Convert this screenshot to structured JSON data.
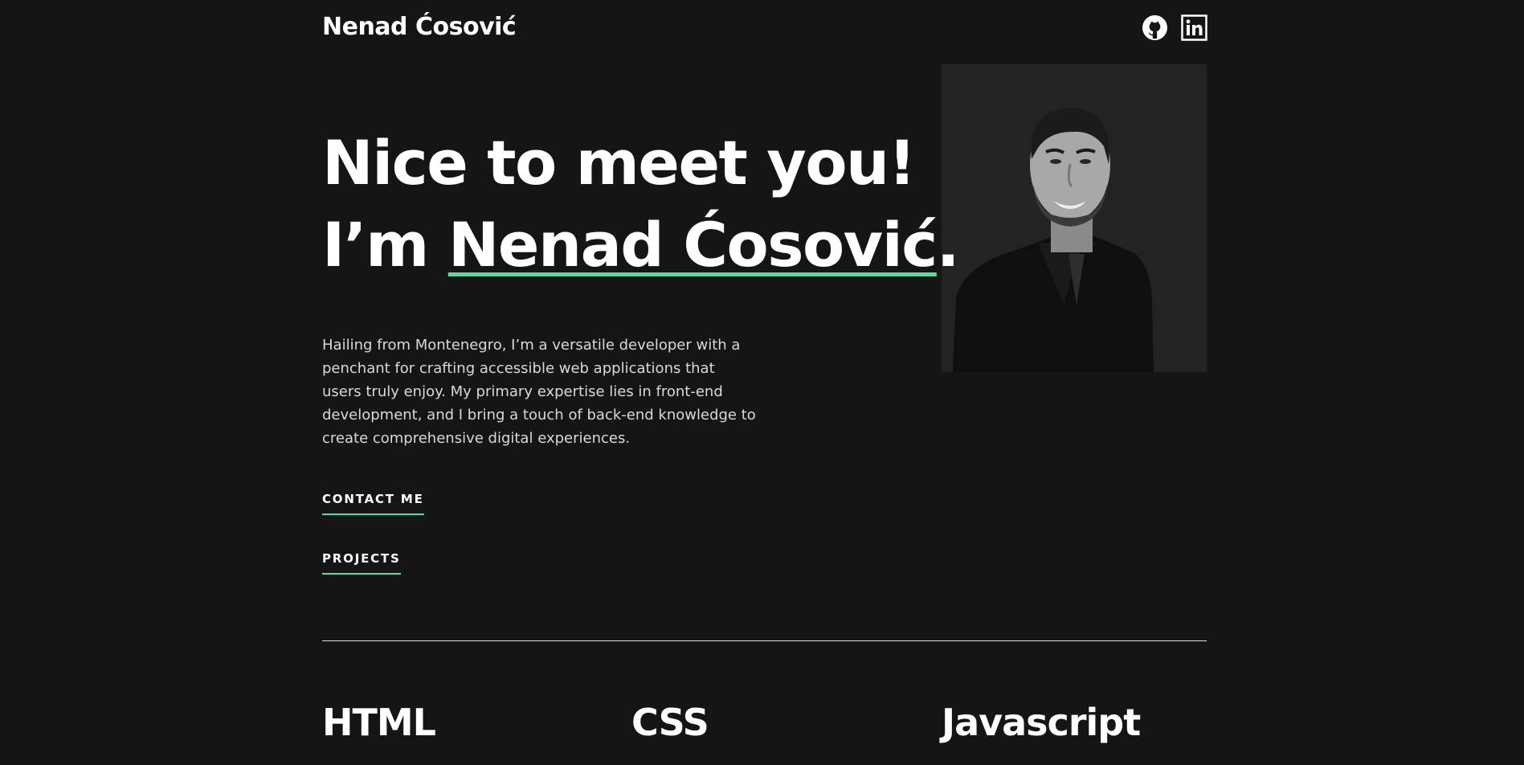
{
  "header": {
    "logo": "Nenad Ćosović",
    "socials": [
      {
        "name": "GitHub",
        "icon": "github-icon"
      },
      {
        "name": "LinkedIn",
        "icon": "linkedin-icon"
      }
    ]
  },
  "hero": {
    "greeting": "Nice to meet you!",
    "intro_prefix": "I’m ",
    "name": "Nenad Ćosović",
    "name_suffix": ".",
    "description": "Hailing from Montenegro, I’m a versatile developer with a penchant for crafting accessible web applications that users truly enjoy. My primary expertise lies in front-end development, and I bring a touch of back-end knowledge to create comprehensive digital experiences.",
    "contact_label": "CONTACT ME",
    "projects_label": "PROJECTS",
    "photo": "portrait-photo"
  },
  "skills": [
    {
      "name": "HTML"
    },
    {
      "name": "CSS"
    },
    {
      "name": "Javascript"
    }
  ],
  "colors": {
    "background": "#151515",
    "accent": "#4ee1a0",
    "text": "#ffffff",
    "muted_text": "#d9d9d9"
  }
}
